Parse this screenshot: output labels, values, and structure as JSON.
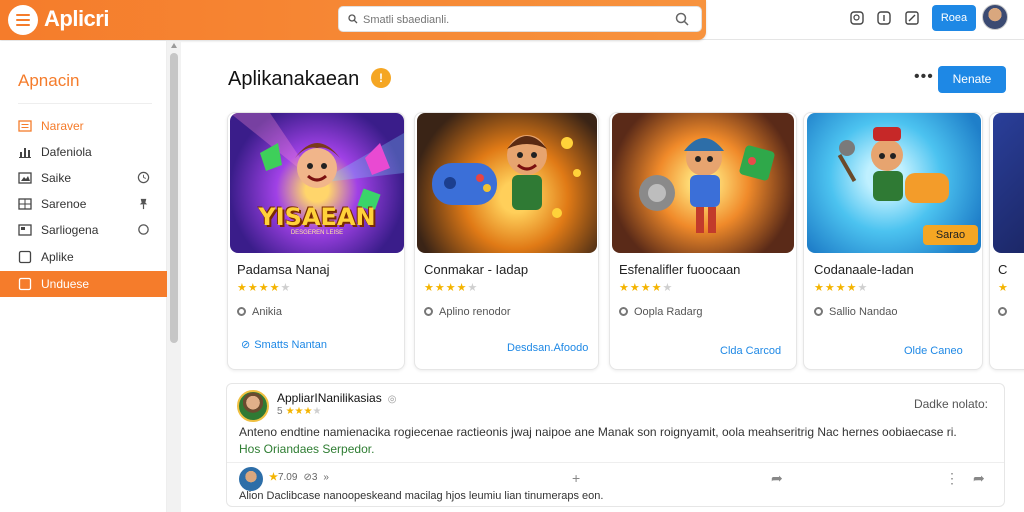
{
  "header": {
    "brand": "Aplicri",
    "search_placeholder": "Smatli sbaedianli.",
    "button_label": "Roea"
  },
  "sidebar": {
    "title": "Apnacin",
    "items": [
      {
        "label": "Naraver",
        "icon": "list-icon",
        "extra": ""
      },
      {
        "label": "Dafeniola",
        "icon": "bar-chart-icon",
        "extra": ""
      },
      {
        "label": "Saike",
        "icon": "image-icon",
        "extra": "clock"
      },
      {
        "label": "Sarenoe",
        "icon": "grid-icon",
        "extra": "pin"
      },
      {
        "label": "Sarliogena",
        "icon": "photo-icon",
        "extra": "circle"
      },
      {
        "label": "Aplike",
        "icon": "square-icon",
        "extra": ""
      },
      {
        "label": "Unduese",
        "icon": "square-icon",
        "extra": ""
      }
    ]
  },
  "main": {
    "title": "Aplikanakaean",
    "badge": "!",
    "primary_button": "Nenate",
    "more": "•••"
  },
  "cards": [
    {
      "title": "Padamsa Nanaj",
      "rating": 4,
      "developer": "Anikia",
      "cta": "Smatts Nantan",
      "art_text": "YISAEAN",
      "art_sub": "DESGEREN LEISE"
    },
    {
      "title": "Conmakar - Iadap",
      "rating": 4,
      "developer": "Aplino renodor",
      "cta": "Desdsan.Afoodo",
      "art_text": "",
      "art_sub": ""
    },
    {
      "title": "Esfenalifler fuoocaan",
      "rating": 4,
      "developer": "Oopla Radarg",
      "cta": "Clda Carcod",
      "art_text": "",
      "art_sub": ""
    },
    {
      "title": "Codanaale-Iadan",
      "rating": 4,
      "developer": "Sallio Nandao",
      "cta": "Olde Caneo",
      "art_text": "Sarao",
      "art_sub": ""
    }
  ],
  "review": {
    "author": "AppliarINanilikasias",
    "rating_text": "5",
    "date": "Dadke nolato:",
    "body": "Anteno endtine namienacika rogiecenae ractieonis jwaj naipoe ane Manak son roignyamit, oola meahseritrig Nac hernes oobiaecase ri.",
    "tags": "Hos Oriandaes Serpedor.",
    "stats": "7.09",
    "stats_sub": "3",
    "footer": "Alion Daclibcase nanoopeskeand macilag hjos leumiu lian tinumeraps eon."
  },
  "colors": {
    "brand": "#f57c2b",
    "accent": "#1e88e5",
    "star": "#f4b400"
  }
}
